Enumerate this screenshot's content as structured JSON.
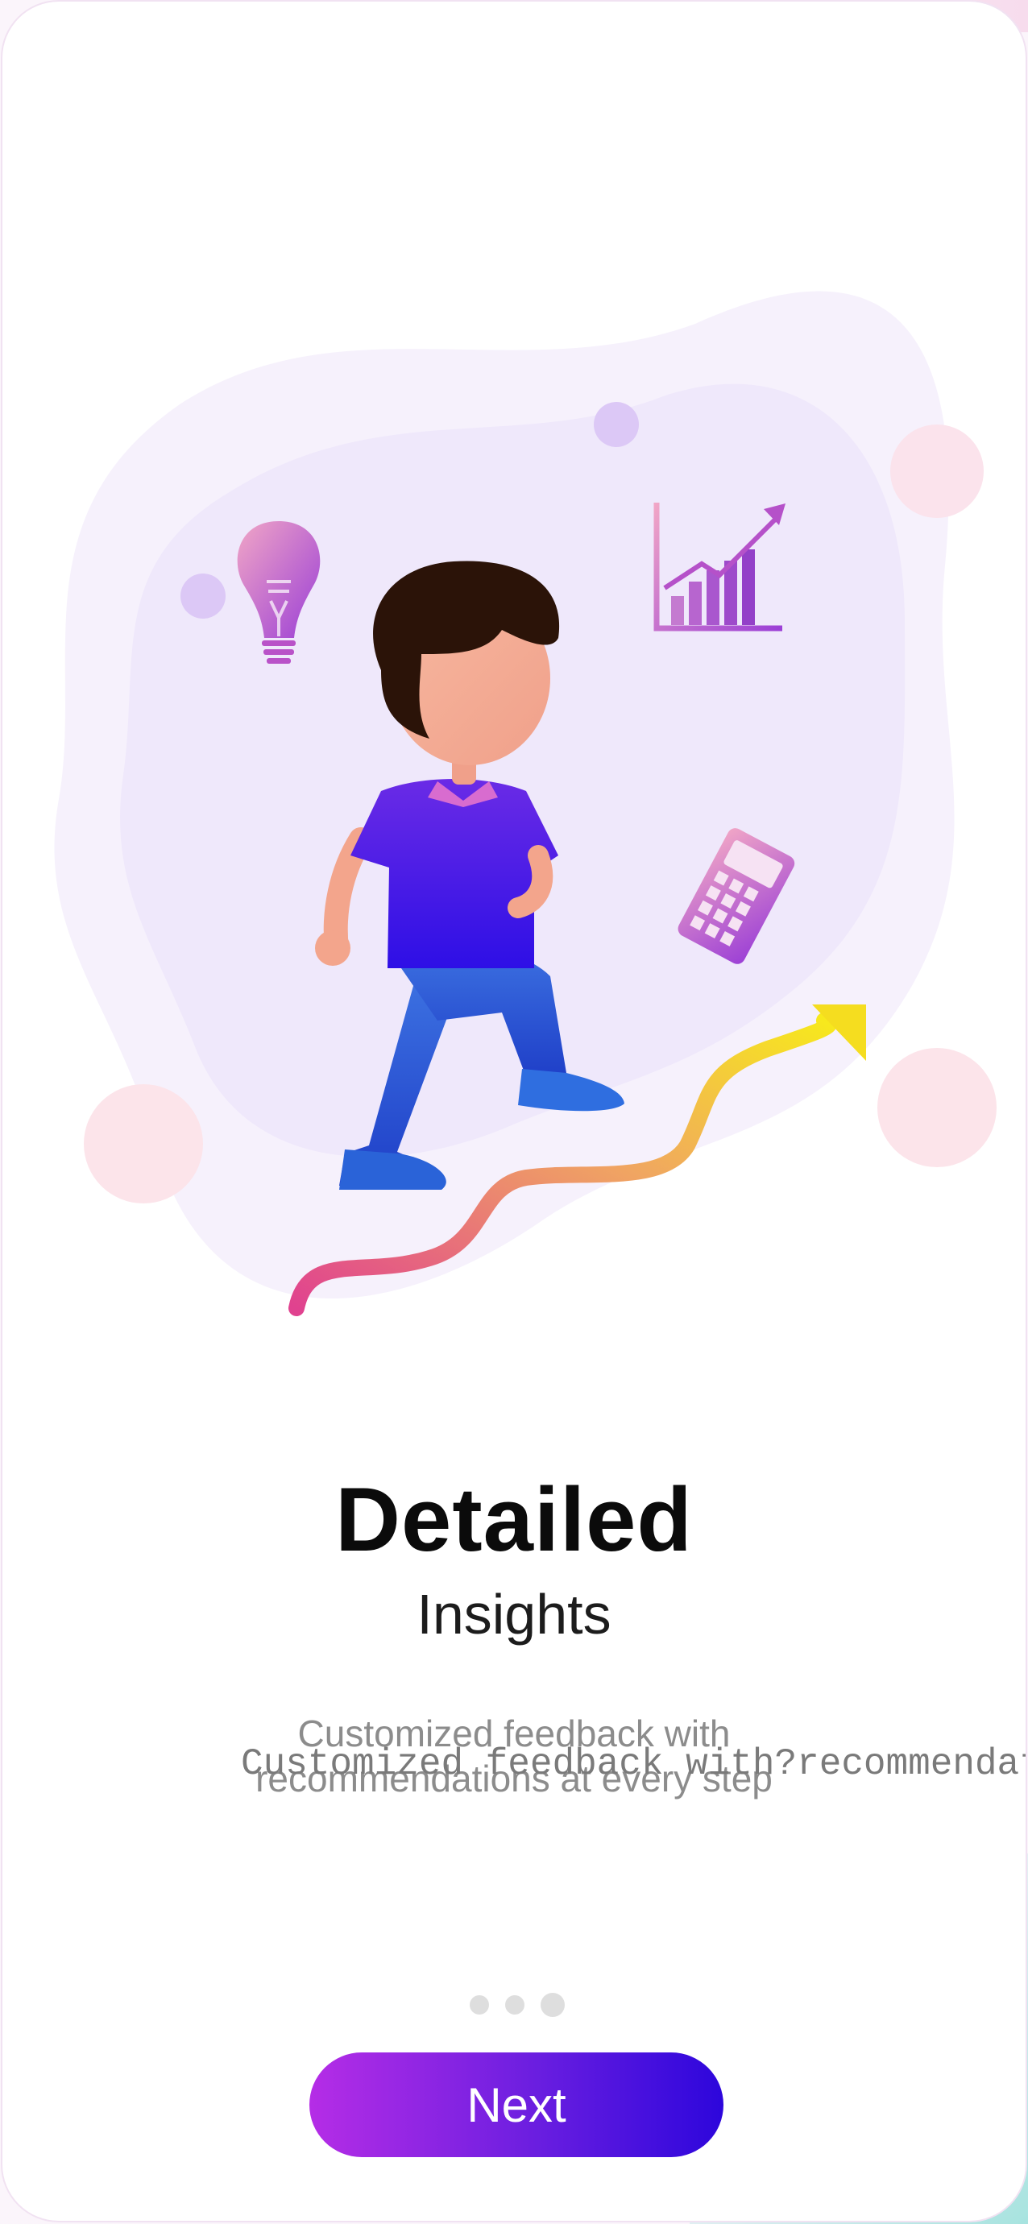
{
  "onboarding": {
    "title": "Detailed",
    "subtitle": "Insights",
    "description_line1": "Customized feedback with",
    "description_line2": "recommendations at every step",
    "description_overlay": "Customized feedback with?recommendations at every step",
    "next_label": "Next"
  },
  "pagination": {
    "total": 3,
    "active_index": 2
  },
  "colors": {
    "button_start": "#b52de6",
    "button_end": "#2d06dc",
    "shirt": "#4d1ee8",
    "pants": "#2b5fd6",
    "arrow_start": "#e0428f",
    "arrow_end": "#f7e91c",
    "blob": "#efe8fb"
  },
  "icons": [
    "lightbulb-icon",
    "bar-chart-icon",
    "calculator-icon",
    "growth-arrow-icon"
  ]
}
